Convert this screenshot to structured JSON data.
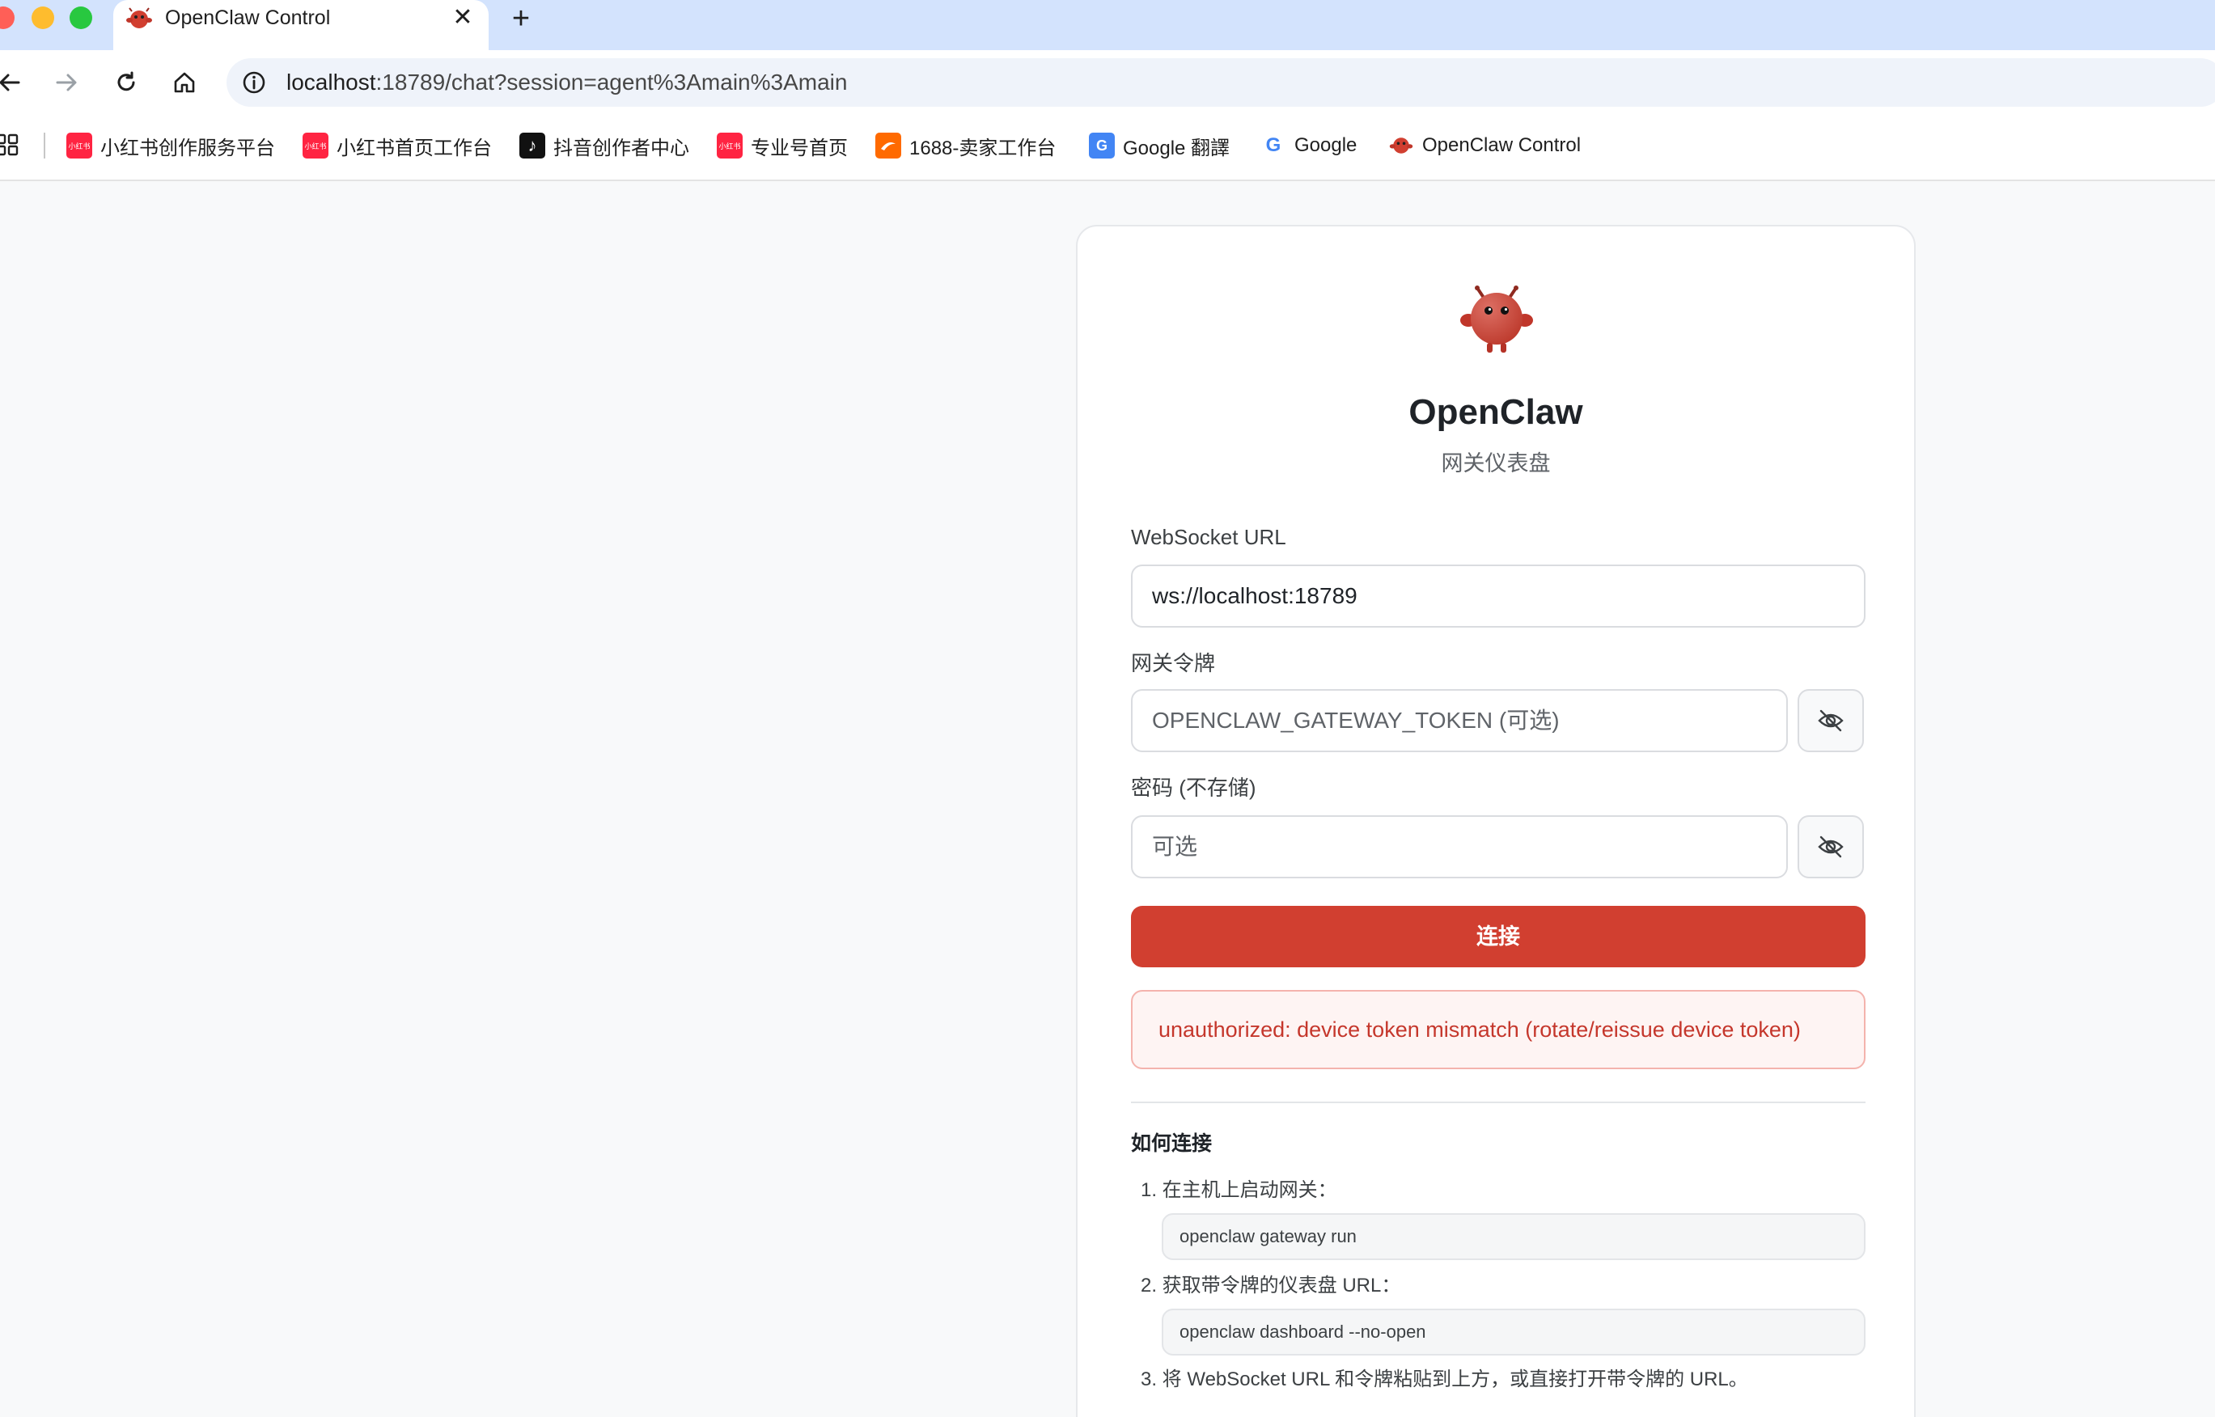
{
  "browser": {
    "tab": {
      "title": "OpenClaw Control",
      "close_glyph": "✕"
    },
    "new_tab_glyph": "+",
    "address": {
      "host": "localhost",
      "rest": ":18789/chat?session=agent%3Amain%3Amain"
    },
    "bookmarks": [
      {
        "label": "小红书创作服务平台",
        "icon": "xiaohongshu-icon",
        "color": "#ff2442",
        "icon_text": "小红书"
      },
      {
        "label": "小红书首页工作台",
        "icon": "xiaohongshu-icon",
        "color": "#ff2442",
        "icon_text": "小红书"
      },
      {
        "label": "抖音创作者中心",
        "icon": "douyin-icon",
        "color": "#111111",
        "icon_text": "♪"
      },
      {
        "label": "专业号首页",
        "icon": "xiaohongshu-icon",
        "color": "#ff2442",
        "icon_text": "小红书"
      },
      {
        "label": "1688-卖家工作台",
        "icon": "1688-icon",
        "color": "#ff6a00",
        "icon_text": ""
      },
      {
        "label": "Google 翻譯",
        "icon": "google-translate-icon",
        "color": "#4285f4",
        "icon_text": "G"
      },
      {
        "label": "Google",
        "icon": "google-icon",
        "color": "#ffffff",
        "icon_text": "G"
      },
      {
        "label": "OpenClaw Control",
        "icon": "openclaw-icon",
        "color": "#d13f30",
        "icon_text": ""
      }
    ]
  },
  "card": {
    "title": "OpenClaw",
    "subtitle": "网关仪表盘",
    "ws_label": "WebSocket URL",
    "ws_value": "ws://localhost:18789",
    "token_label": "网关令牌",
    "token_placeholder": "OPENCLAW_GATEWAY_TOKEN (可选)",
    "password_label": "密码 (不存储)",
    "password_placeholder": "可选",
    "connect_label": "连接",
    "error_message": "unauthorized: device token mismatch (rotate/reissue device token)",
    "howto_title": "如何连接",
    "steps": [
      {
        "text": "1. 在主机上启动网关：",
        "code": "openclaw gateway run"
      },
      {
        "text": "2. 获取带令牌的仪表盘 URL：",
        "code": "openclaw dashboard --no-open"
      },
      {
        "text": "3. 将 WebSocket URL 和令牌粘贴到上方，或直接打开带令牌的 URL。"
      }
    ]
  },
  "colors": {
    "accent": "#d13f30",
    "error_text": "#c5372c",
    "error_bg": "#fef4f3",
    "tabstrip": "#d3e3fd"
  }
}
